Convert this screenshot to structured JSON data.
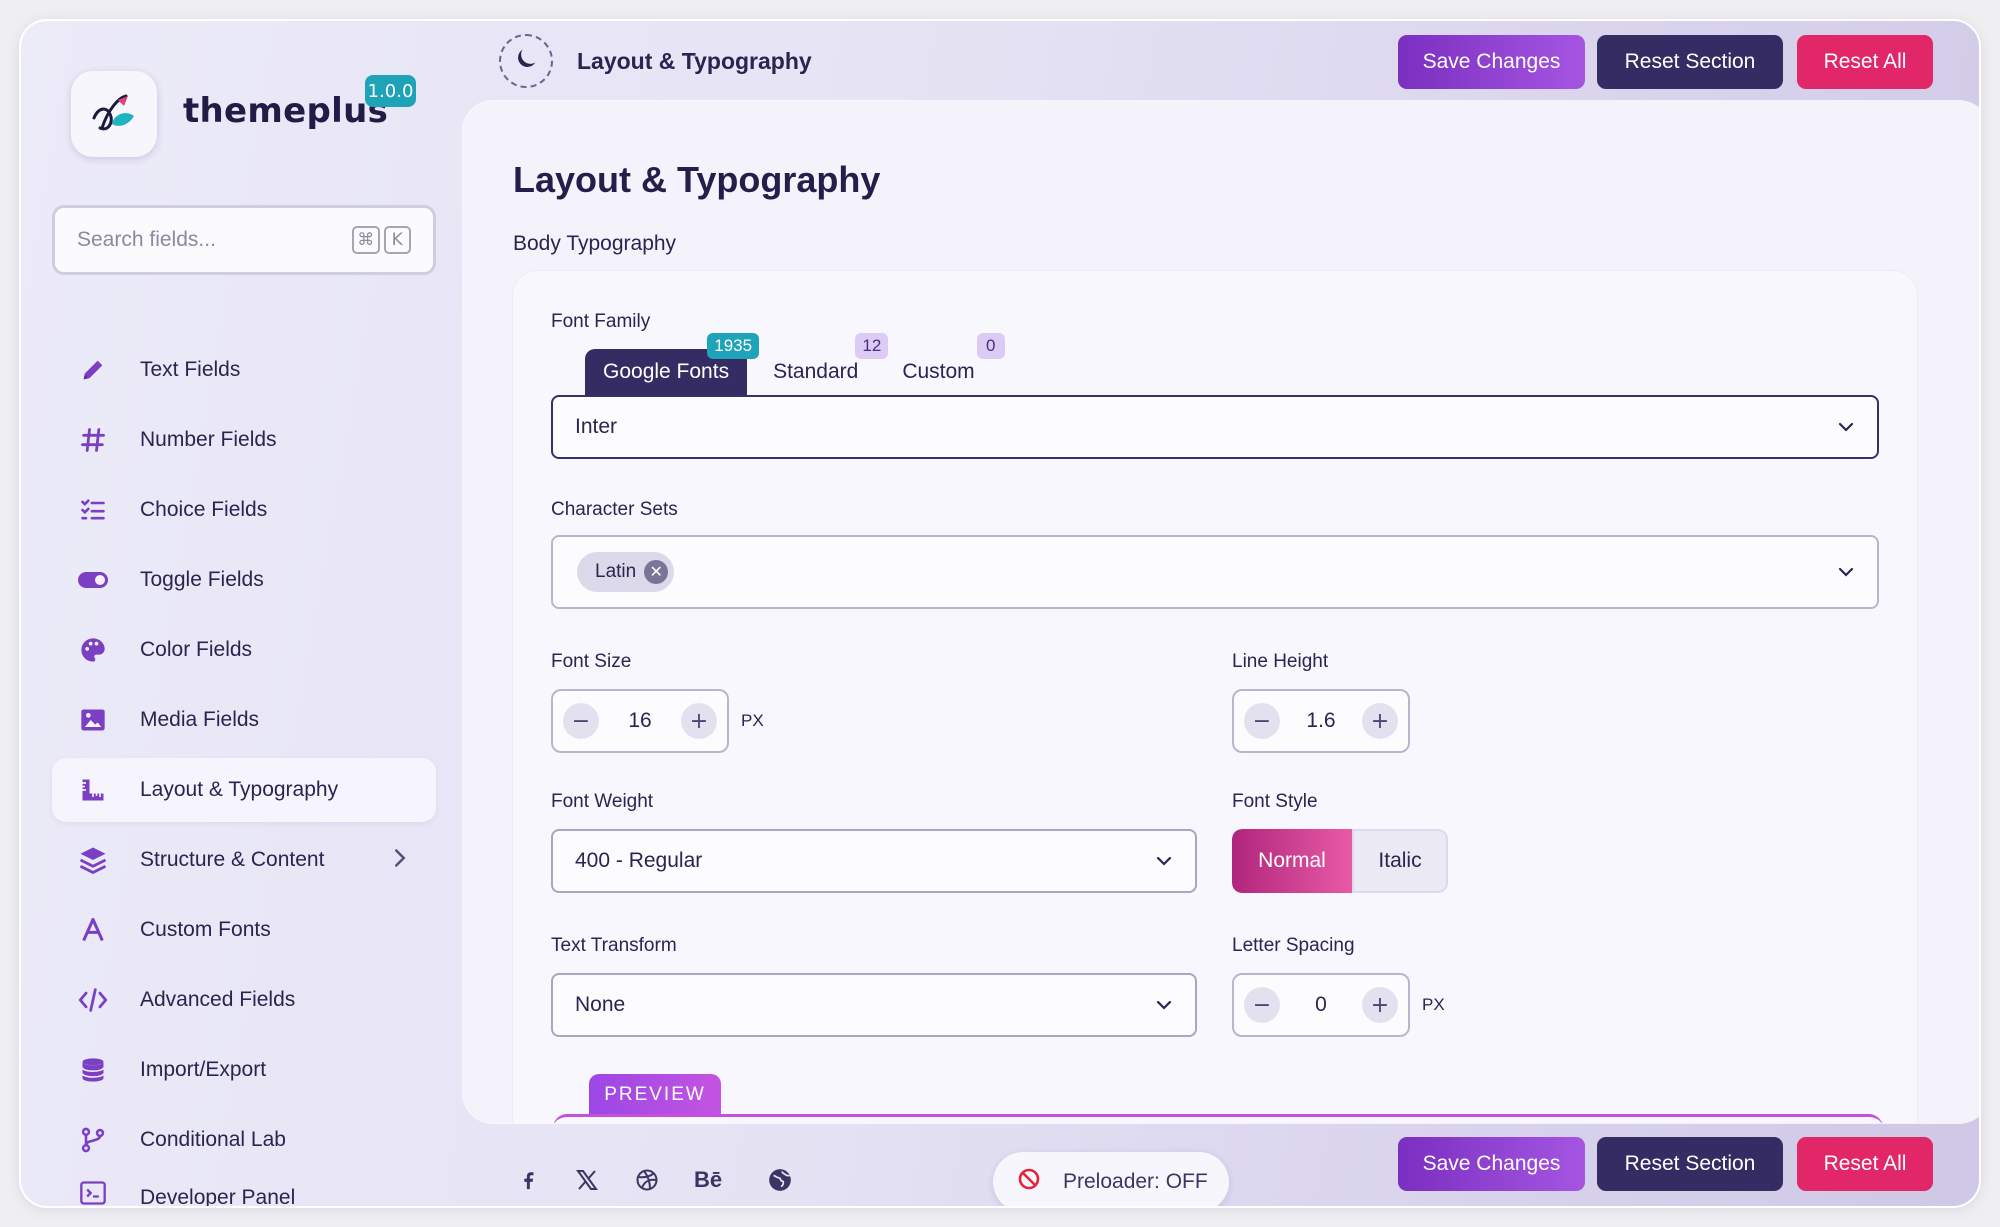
{
  "brand": {
    "name": "themeplus",
    "version": "1.0.0"
  },
  "search": {
    "placeholder": "Search fields...",
    "shortcut_mod": "⌘",
    "shortcut_key": "K"
  },
  "sidebar": {
    "items": [
      {
        "label": "Text Fields",
        "icon": "pencil-icon"
      },
      {
        "label": "Number Fields",
        "icon": "hash-icon"
      },
      {
        "label": "Choice Fields",
        "icon": "checklist-icon"
      },
      {
        "label": "Toggle Fields",
        "icon": "toggle-icon"
      },
      {
        "label": "Color Fields",
        "icon": "palette-icon"
      },
      {
        "label": "Media Fields",
        "icon": "image-icon"
      },
      {
        "label": "Layout & Typography",
        "icon": "ruler-icon",
        "active": true
      },
      {
        "label": "Structure & Content",
        "icon": "layers-icon",
        "has_children": true
      },
      {
        "label": "Custom Fonts",
        "icon": "letter-a-icon"
      },
      {
        "label": "Advanced Fields",
        "icon": "code-icon"
      },
      {
        "label": "Import/Export",
        "icon": "database-icon"
      },
      {
        "label": "Conditional Lab",
        "icon": "branch-icon"
      },
      {
        "label": "Developer Panel",
        "icon": "terminal-icon"
      }
    ]
  },
  "header": {
    "title": "Layout & Typography",
    "save_label": "Save Changes",
    "reset_section_label": "Reset Section",
    "reset_all_label": "Reset All"
  },
  "main": {
    "title": "Layout & Typography",
    "section_label": "Body Typography",
    "font_family": {
      "label": "Font Family",
      "tabs": [
        {
          "label": "Google Fonts",
          "count": "1935",
          "active": true
        },
        {
          "label": "Standard",
          "count": "12"
        },
        {
          "label": "Custom",
          "count": "0"
        }
      ],
      "value": "Inter"
    },
    "character_sets": {
      "label": "Character Sets",
      "chips": [
        "Latin"
      ]
    },
    "font_size": {
      "label": "Font Size",
      "value": "16",
      "unit": "PX"
    },
    "line_height": {
      "label": "Line Height",
      "value": "1.6"
    },
    "font_weight": {
      "label": "Font Weight",
      "value": "400 - Regular"
    },
    "font_style": {
      "label": "Font Style",
      "options": [
        "Normal",
        "Italic"
      ],
      "selected": "Normal"
    },
    "text_transform": {
      "label": "Text Transform",
      "value": "None"
    },
    "letter_spacing": {
      "label": "Letter Spacing",
      "value": "0",
      "unit": "PX"
    },
    "preview_label": "PREVIEW"
  },
  "footer": {
    "social": [
      "facebook-icon",
      "x-icon",
      "dribbble-icon",
      "behance-icon",
      "globe-icon"
    ],
    "behance_text": "Bē",
    "preloader": "Preloader: OFF",
    "save_label": "Save Changes",
    "reset_section_label": "Reset Section",
    "reset_all_label": "Reset All"
  },
  "colors": {
    "accent_purple": "#7b2fc0",
    "dark_navy": "#352c63",
    "danger_pink": "#e12767",
    "teal_badge": "#1ea3b8"
  }
}
